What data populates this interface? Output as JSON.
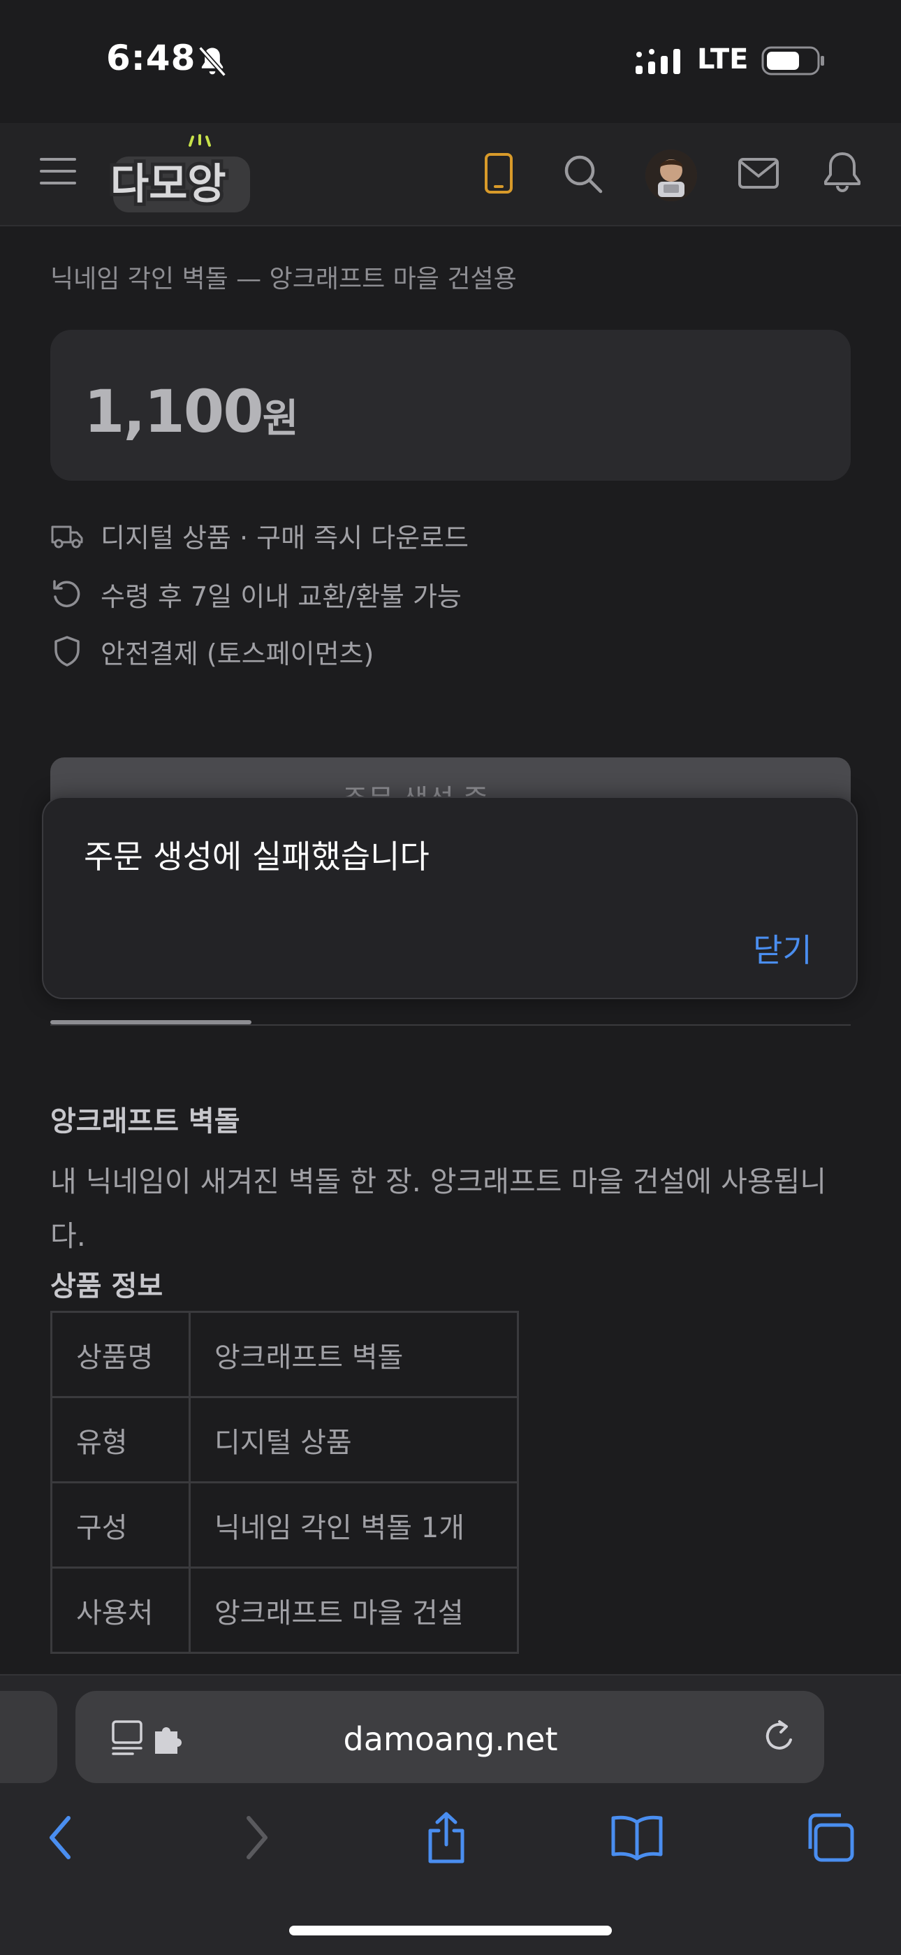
{
  "status_bar": {
    "time": "6:48",
    "network": "LTE"
  },
  "header": {
    "logo_text": "다모앙",
    "icons": [
      "menu-icon",
      "phone-icon",
      "search-icon",
      "avatar",
      "mail-icon",
      "bell-icon"
    ]
  },
  "product": {
    "breadcrumb": "닉네임 각인 벽돌 — 앙크래프트 마을 건설용",
    "price_value": "1,100",
    "price_unit": "원",
    "features": [
      {
        "icon": "truck-icon",
        "text": "디지털 상품 · 구매 즉시 다운로드"
      },
      {
        "icon": "return-icon",
        "text": "수령 후 7일 이내 교환/환불 가능"
      },
      {
        "icon": "shield-icon",
        "text": "안전결제 (토스페이먼츠)"
      }
    ],
    "order_button_label": "주문 생성 중",
    "section_title": "앙크래프트 벽돌",
    "description": "내 닉네임이 새겨진 벽돌 한 장. 앙크래프트 마을 건설에 사용됩니다.",
    "info_title": "상품 정보",
    "info_table": [
      {
        "key": "상품명",
        "value": "앙크래프트 벽돌"
      },
      {
        "key": "유형",
        "value": "디지털 상품"
      },
      {
        "key": "구성",
        "value": "닉네임 각인 벽돌 1개"
      },
      {
        "key": "사용처",
        "value": "앙크래프트 마을 건설"
      }
    ]
  },
  "dialog": {
    "message": "주문 생성에 실패했습니다",
    "close_label": "닫기"
  },
  "browser": {
    "url": "damoang.net"
  },
  "colors": {
    "accent": "#4a8ef0",
    "background": "#1c1c1e",
    "phone_icon": "#d89a2a"
  }
}
